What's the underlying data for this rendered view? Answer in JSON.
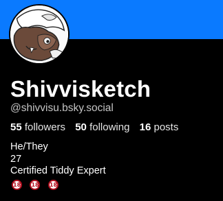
{
  "colors": {
    "banner": "#0a7aff",
    "badge_ring": "#b20f1f"
  },
  "profile": {
    "display_name": "Shivvisketch",
    "handle": "@shivvisu.bsky.social",
    "avatar_icon": "profile-avatar-image"
  },
  "stats": {
    "followers_count": "55",
    "followers_label": "followers",
    "following_count": "50",
    "following_label": "following",
    "posts_count": "16",
    "posts_label": "posts"
  },
  "bio": {
    "lines": [
      "He/They",
      "27",
      "Certified Tiddy Expert"
    ],
    "emoji": [
      "🔞",
      "🔞",
      "🔞"
    ],
    "emoji_text": "18"
  }
}
